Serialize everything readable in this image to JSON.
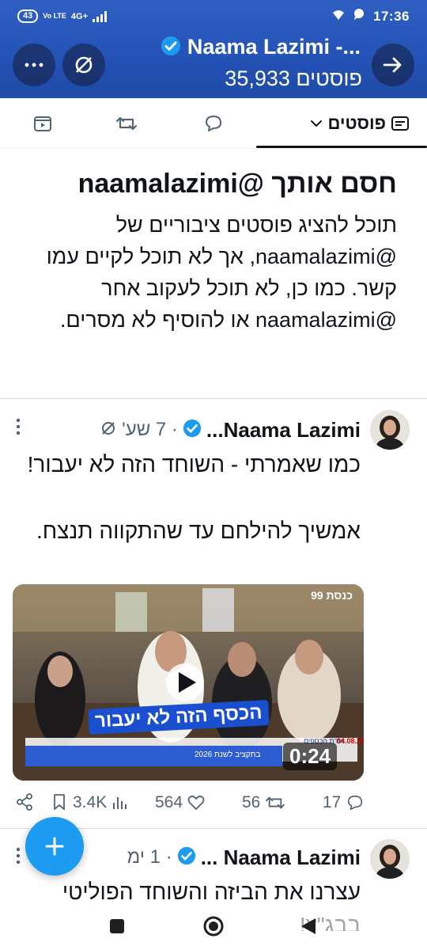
{
  "status_bar": {
    "battery": "43",
    "volte": "Vo LTE",
    "network": "4G+",
    "time": "17:36"
  },
  "header": {
    "profile_name": "Naama Lazimi -...",
    "post_count": "35,933 פוסטים"
  },
  "tabs": {
    "posts_label": "פוסטים"
  },
  "blocked_notice": {
    "title": "חסם אותך @naamalazimi",
    "body": "תוכל להציג פוסטים ציבוריים של @naamalazimi, אך לא תוכל לקיים עמו קשר. כמו כן, לא תוכל לעקוב אחר @naamalazimi או להוסיף לא מסרים."
  },
  "post1": {
    "author": "Naama Lazimi...",
    "time": "· 7 שע'",
    "line1": "כמו שאמרתי - השוחד הזה לא יעבור!",
    "line2": "אמשיך להילחם עד שהתקווה תנצח.",
    "media": {
      "channel": "כנסת 99",
      "banner": "הכסף הזה לא יעבור",
      "caption": "בתקציב לשנת 2026",
      "committee": "ועדת הכספים",
      "date": "04.08.26",
      "duration": "0:24"
    },
    "stats": {
      "views": "3.4K",
      "likes": "564",
      "reposts": "56",
      "replies": "17"
    }
  },
  "post2": {
    "author": "Naama Lazimi ...",
    "time": "· 1 ימ",
    "line1": "עצרנו את הביזה והשוחד הפוליטי",
    "line2": "בבג\"ץ!"
  },
  "colors": {
    "header_blue": "#2452b6",
    "accent": "#1d9bf0",
    "muted": "#536471",
    "verified": "#1d9bf0"
  }
}
